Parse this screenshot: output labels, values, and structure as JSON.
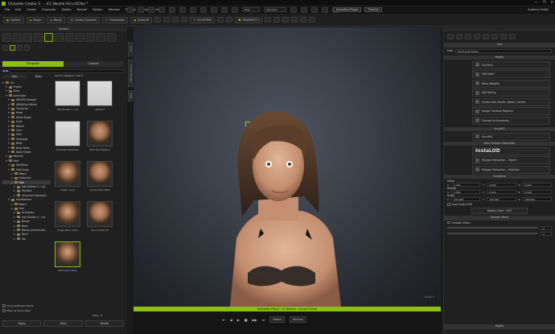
{
  "window": {
    "title": "Character Creator 5 - ...\\CC Neutral Full.cc4Char *",
    "controls": [
      "—",
      "❐",
      "✕"
    ]
  },
  "menubar": {
    "items": [
      "File",
      "Edit",
      "Create",
      "Character",
      "Modify",
      "Render",
      "Motion",
      "Window",
      "Plugins",
      "Script",
      "Help"
    ],
    "quality": "High",
    "display": "Standard",
    "animation_player": "Animation Player",
    "timeline": "Timeline",
    "profile": "Audience Profile"
  },
  "toolbar": {
    "buttons": [
      "Content",
      "Morph",
      "Morph",
      "Create Character",
      "Transformer"
    ],
    "icon_buttons": [
      "InstaLOD",
      "SCULPTING",
      "HEADSHOT 2"
    ]
  },
  "left_panel": {
    "title": "Content",
    "tab_template": "Template",
    "tab_custom": "Custom",
    "subtab_hair": "Hair",
    "subtab_body": "Body",
    "breadcrumb": "Sort to Category: Hair ▾",
    "tree": [
      {
        "label": "All",
        "level": 0
      },
      {
        "label": "Project",
        "level": 1
      },
      {
        "label": "Actor",
        "level": 1
      },
      {
        "label": "Actorbuild",
        "level": 1
      },
      {
        "label": "WEVER Package",
        "level": 2
      },
      {
        "label": "ARKit/Eye Wheel",
        "level": 2
      },
      {
        "label": "Character",
        "level": 2
      },
      {
        "label": "Head",
        "level": 2
      },
      {
        "label": "Head Shape",
        "level": 2
      },
      {
        "label": "Eyes",
        "level": 2
      },
      {
        "label": "Mouth",
        "level": 2
      },
      {
        "label": "Chin",
        "level": 2
      },
      {
        "label": "Ears",
        "level": 2
      },
      {
        "label": "Forehead",
        "level": 2
      },
      {
        "label": "Body",
        "level": 2
      },
      {
        "label": "Body Ratio",
        "level": 2
      },
      {
        "label": "Body Shape",
        "level": 2
      },
      {
        "label": "Memory",
        "level": 1
      },
      {
        "label": "Hair",
        "level": 1
      },
      {
        "label": "HairMake",
        "level": 2
      },
      {
        "label": "HairGroup",
        "level": 2
      },
      {
        "label": "Beard",
        "level": 3
      },
      {
        "label": "Eyebrows",
        "level": 3
      },
      {
        "label": "Hair",
        "level": 3,
        "selected": true
      },
      {
        "label": "Hair Builder 3 - cut",
        "level": 4
      },
      {
        "label": "Stylized",
        "level": 4
      },
      {
        "label": "Universal Hairstyles",
        "level": 4
      },
      {
        "label": "HairMaterial",
        "level": 2
      },
      {
        "label": "Beard",
        "level": 3
      },
      {
        "label": "Hair",
        "level": 3
      },
      {
        "label": "Accessory",
        "level": 4
      },
      {
        "label": "Hair Builder 3 - cut",
        "level": 4
      },
      {
        "label": "Bangs",
        "level": 4
      },
      {
        "label": "Base",
        "level": 4
      },
      {
        "label": "Bonus_Accessories",
        "level": 4
      },
      {
        "label": "Back",
        "level": 4
      },
      {
        "label": "Top",
        "level": 4
      }
    ],
    "grid": [
      {
        "label": "Hair Builder 3 - cut"
      },
      {
        "label": "Stylized"
      },
      {
        "label": "Universal Hairstyles"
      },
      {
        "label": "Ultra Hair Medium"
      },
      {
        "label": "Classic Curls"
      },
      {
        "label": "Curved Slick Back"
      },
      {
        "label": "Fringe Wavy Short"
      },
      {
        "label": "Short Undercut"
      },
      {
        "label": "Short part messy"
      }
    ],
    "footer": {
      "show_subfolder": "Show Subfolder Items",
      "filter": "Filter by Show Type",
      "total": "Total : 9",
      "apply": "Apply",
      "save": "Save",
      "delete": "Delete"
    }
  },
  "side_tabs": [
    "Scene",
    "Content Manager",
    "Visual"
  ],
  "viewport": {
    "bottom_label": "Animation Player - CC Neutral - Current Frame",
    "frame": "Build 1",
    "play_controls": [
      "⏮",
      "◀",
      "▶",
      "■",
      "▶▶",
      "⏭"
    ],
    "motion_label": "Motion",
    "footer_label": "Reverse"
  },
  "right_panel": {
    "title": "Modify",
    "edit_label": "Edit",
    "name_label": "Hair",
    "name_value": "Short part messy",
    "modify_header": "Modify",
    "modify_buttons": [
      "Conform",
      "Edit Mesh",
      "Bone Weights",
      "Edit Spring",
      "Create Hair, Brows, Beard, Lashes",
      "Assign Conform Regions",
      "Convert to Accessory"
    ],
    "accurip_header": "AccuRIG",
    "accurip_button": "AccuRIG",
    "reduction_header": "Mesh Polygon Reduction",
    "instalod": "InstaLOD",
    "poly_object": "Polygon Reduction - Object",
    "poly_selected": "Polygon Reduction - Selected",
    "transform_header": "Transform",
    "move": "Move",
    "rotate": "Rotate",
    "scale": "Scale",
    "move_vals": [
      "0.000",
      "0.000",
      "0.000"
    ],
    "rotate_vals": [
      "0.000",
      "0.000",
      "0.000"
    ],
    "scale_vals": [
      "100.000",
      "100.000",
      "100.000"
    ],
    "lock_label": "Lock Scale XYZ",
    "rotate_order": "Rotate Order : XYZ",
    "smooth_header": "Smooth Mesh",
    "smooth_label": "Smooth Mesh",
    "smooth_vals": [
      "0",
      "0"
    ],
    "bottom_header": "Modify"
  },
  "colors": {
    "accent": "#8cbf14",
    "bg": "#202020"
  }
}
